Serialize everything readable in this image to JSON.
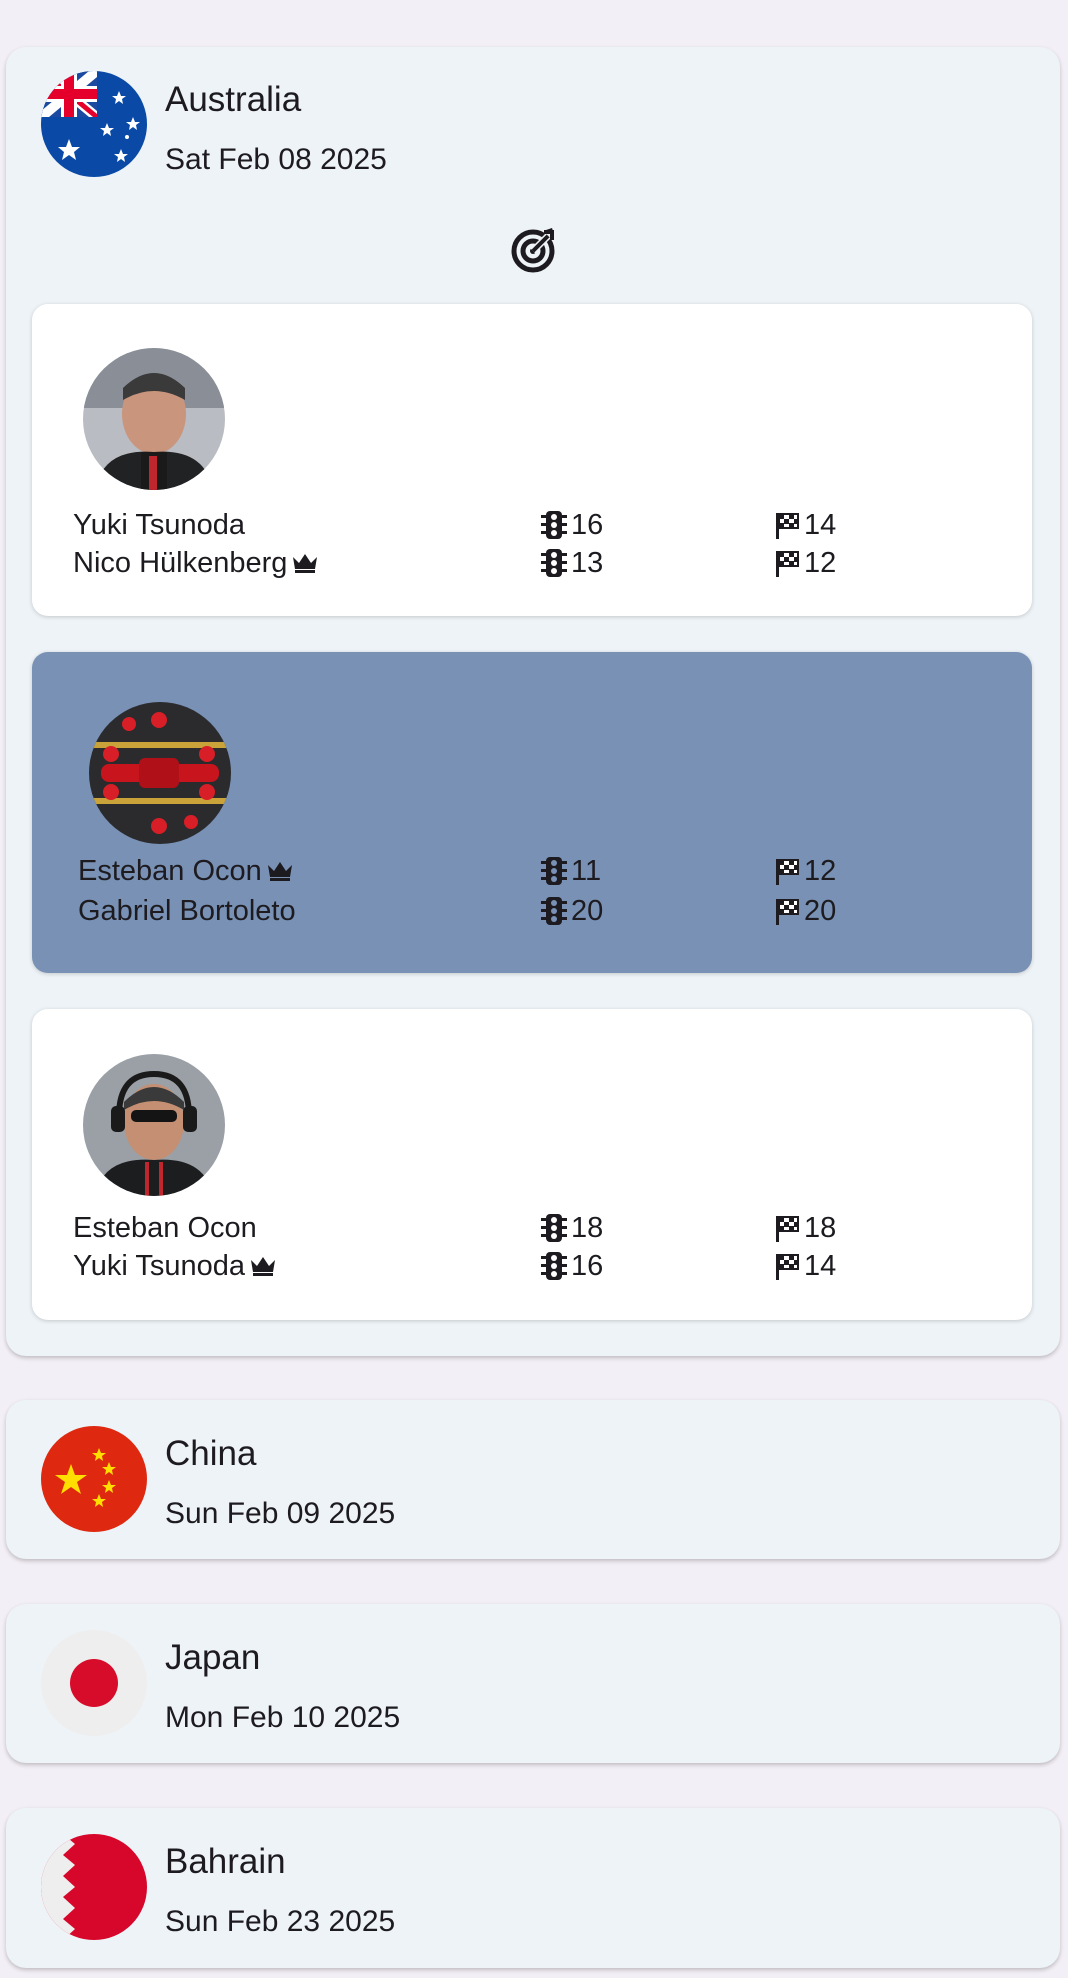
{
  "races": [
    {
      "country": "Australia",
      "date": "Sat Feb 08 2025",
      "flag_icon": "australia-flag-icon",
      "expanded": true,
      "predictions": [
        {
          "avatar_icon": "team-principal-portrait-icon",
          "selected": false,
          "drivers": [
            {
              "name": "Yuki Tsunoda",
              "crown": false,
              "start": "16",
              "finish": "14"
            },
            {
              "name": "Nico Hülkenberg",
              "crown": true,
              "start": "13",
              "finish": "12"
            }
          ]
        },
        {
          "avatar_icon": "ferrari-pit-stop-icon",
          "selected": true,
          "drivers": [
            {
              "name": "Esteban Ocon",
              "crown": true,
              "start": "11",
              "finish": "12"
            },
            {
              "name": "Gabriel Bortoleto",
              "crown": false,
              "start": "20",
              "finish": "20"
            }
          ]
        },
        {
          "avatar_icon": "team-principal-headset-icon",
          "selected": false,
          "drivers": [
            {
              "name": "Esteban Ocon",
              "crown": false,
              "start": "18",
              "finish": "18"
            },
            {
              "name": "Yuki Tsunoda",
              "crown": true,
              "start": "16",
              "finish": "14"
            }
          ]
        }
      ]
    },
    {
      "country": "China",
      "date": "Sun Feb 09 2025",
      "flag_icon": "china-flag-icon",
      "expanded": false
    },
    {
      "country": "Japan",
      "date": "Mon Feb 10 2025",
      "flag_icon": "japan-flag-icon",
      "expanded": false
    },
    {
      "country": "Bahrain",
      "date": "Sun Feb 23 2025",
      "flag_icon": "bahrain-flag-icon",
      "expanded": false
    }
  ],
  "icons": {
    "target": "target-icon",
    "start_position": "traffic-light-icon",
    "finish_position": "checkered-flag-icon",
    "crown": "crown-icon"
  },
  "colors": {
    "background": "#f3eff6",
    "race_card": "#edf3f7",
    "prediction_card": "#ffffff",
    "selected_prediction_card": "#7891b4"
  }
}
